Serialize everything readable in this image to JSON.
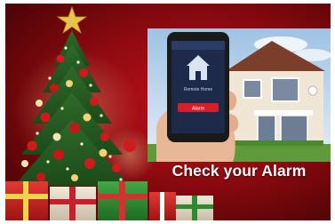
{
  "caption": "Check  your Alarm",
  "phone": {
    "screen_title": "Remote Home",
    "button_label": "Alarm"
  },
  "colors": {
    "background_red": "#a30c14",
    "caption_text": "#ffffff",
    "phone_screen": "#1d2a4a",
    "alarm_button": "#d3202a"
  },
  "icons": [
    "star-icon",
    "house-icon"
  ]
}
